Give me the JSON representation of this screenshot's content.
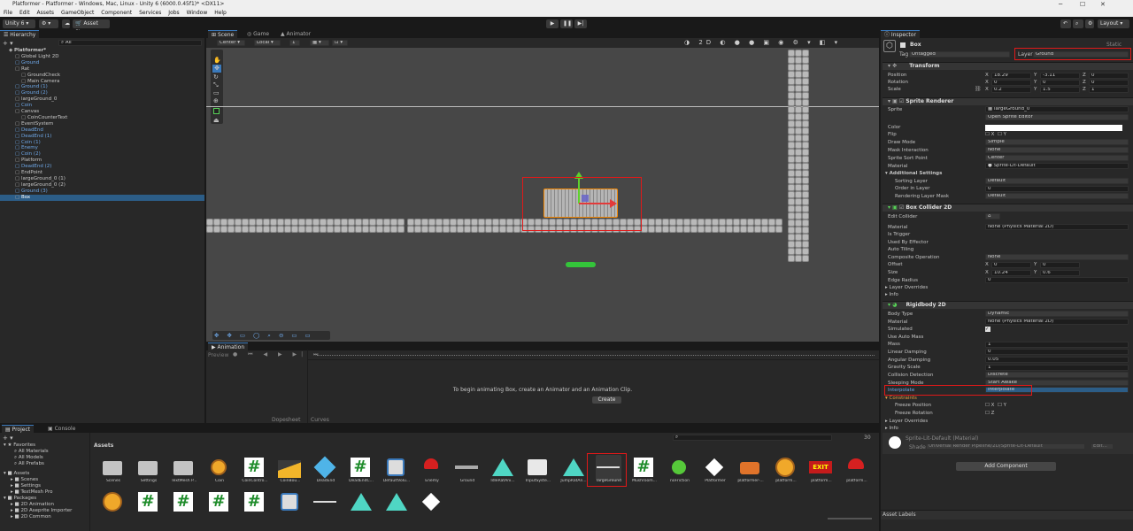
{
  "window": {
    "title": "Platformer - Platformer - Windows, Mac, Linux - Unity 6 (6000.0.45f1)* <DX11>"
  },
  "menu": [
    "File",
    "Edit",
    "Assets",
    "GameObject",
    "Component",
    "Services",
    "Jobs",
    "Window",
    "Help"
  ],
  "toolbar": {
    "account": "Unity 6",
    "asset_store": "Asset Store",
    "layout": "Layout"
  },
  "hierarchy": {
    "title": "Hierarchy",
    "search": "All",
    "items": [
      {
        "label": "Platformer*",
        "indent": 0,
        "style": "root"
      },
      {
        "label": "Global Light 2D",
        "indent": 1,
        "style": "normal"
      },
      {
        "label": "Ground",
        "indent": 1,
        "style": "blue"
      },
      {
        "label": "Rat",
        "indent": 1,
        "style": "normal"
      },
      {
        "label": "GroundCheck",
        "indent": 2,
        "style": "normal"
      },
      {
        "label": "Main Camera",
        "indent": 2,
        "style": "normal"
      },
      {
        "label": "Ground (1)",
        "indent": 1,
        "style": "blue"
      },
      {
        "label": "Ground (2)",
        "indent": 1,
        "style": "blue"
      },
      {
        "label": "largeGround_0",
        "indent": 1,
        "style": "normal"
      },
      {
        "label": "Coin",
        "indent": 1,
        "style": "blue"
      },
      {
        "label": "Canvas",
        "indent": 1,
        "style": "normal"
      },
      {
        "label": "CoinCounterText",
        "indent": 2,
        "style": "normal"
      },
      {
        "label": "EventSystem",
        "indent": 1,
        "style": "normal"
      },
      {
        "label": "DeadEnd",
        "indent": 1,
        "style": "blue"
      },
      {
        "label": "DeadEnd (1)",
        "indent": 1,
        "style": "blue"
      },
      {
        "label": "Coin (1)",
        "indent": 1,
        "style": "blue"
      },
      {
        "label": "Enemy",
        "indent": 1,
        "style": "blue"
      },
      {
        "label": "Coin (2)",
        "indent": 1,
        "style": "blue"
      },
      {
        "label": "Platform",
        "indent": 1,
        "style": "normal"
      },
      {
        "label": "DeadEnd (2)",
        "indent": 1,
        "style": "blue"
      },
      {
        "label": "EndPoint",
        "indent": 1,
        "style": "normal"
      },
      {
        "label": "largeGround_0 (1)",
        "indent": 1,
        "style": "normal"
      },
      {
        "label": "largeGround_0 (2)",
        "indent": 1,
        "style": "normal"
      },
      {
        "label": "Ground (3)",
        "indent": 1,
        "style": "blue"
      },
      {
        "label": "Box",
        "indent": 1,
        "style": "selected"
      }
    ]
  },
  "scene": {
    "tabs": [
      "Scene",
      "Game",
      "Animator"
    ],
    "pivot": "Center",
    "space": "Local",
    "grid_snap": "1"
  },
  "animation": {
    "title": "Animation",
    "preview": "Preview",
    "message": "To begin animating Box, create an Animator and an Animation Clip.",
    "create": "Create",
    "tab_dopesheet": "Dopesheet",
    "tab_curves": "Curves"
  },
  "project": {
    "tabs": [
      "Project",
      "Console"
    ],
    "count": "30",
    "favorites": "Favorites",
    "fav_items": [
      "All Materials",
      "All Models",
      "All Prefabs"
    ],
    "assets": "Assets",
    "asset_folders": [
      "Scenes",
      "Settings",
      "TextMesh Pro"
    ],
    "packages": "Packages",
    "package_items": [
      "2D Animation",
      "2D Aseprite Importer",
      "2D Common"
    ],
    "breadcrumb": "Assets",
    "grid": [
      "Scenes",
      "Settings",
      "TextMesh P...",
      "Coin",
      "CoinContro...",
      "CoinBou...",
      "DeadEnd",
      "DeadEndC...",
      "DefaultVolu...",
      "Enemy",
      "Ground",
      "IdleRatAni...",
      "InputSyste...",
      "JumpRatAn...",
      "largeGround",
      "Mushroom...",
      "noFriction",
      "Platformer",
      "platformer-...",
      "platform...",
      "platform...",
      "platform..."
    ]
  },
  "inspector": {
    "title": "Inspector",
    "object": "Box",
    "static": "Static",
    "tag_label": "Tag",
    "tag": "Untagged",
    "layer_label": "Layer",
    "layer": "Ground",
    "transform": {
      "title": "Transform",
      "position": [
        "18.29",
        "-3.11",
        "0"
      ],
      "rotation": [
        "0",
        "0",
        "0"
      ],
      "scale": [
        "0.2",
        "1.5",
        "1"
      ]
    },
    "sprite_renderer": {
      "title": "Sprite Renderer",
      "sprite": "largeGround_0",
      "open_editor": "Open Sprite Editor",
      "draw_mode": "Simple",
      "mask": "None",
      "sort_point": "Center",
      "material": "Sprite-Lit-Default",
      "sorting_layer": "Default",
      "order": "0",
      "render_mask": "Default"
    },
    "box_collider": {
      "title": "Box Collider 2D",
      "material": "None (Physics Material 2D)",
      "composite": "None",
      "offset": [
        "0",
        "0"
      ],
      "size": [
        "10.24",
        "0.6"
      ],
      "edge_radius": "0"
    },
    "rigidbody": {
      "title": "Rigidbody 2D",
      "body_type": "Dynamic",
      "material": "None (Physics Material 2D)",
      "mass": "1",
      "linear_damping": "0",
      "angular_damping": "0.05",
      "gravity": "1",
      "collision": "Discrete",
      "sleeping": "Start Awake",
      "interpolate": "Interpolate"
    },
    "mat_name": "Sprite-Lit-Default (Material)",
    "shader_label": "Shader",
    "shader": "Universal Render Pipeline/2D/Sprite-Lit-Default",
    "edit": "Edit...",
    "add_component": "Add Component",
    "asset_labels": "Asset Labels"
  },
  "colors": {
    "accent": "#3a79bb",
    "highlight": "#e01919",
    "selection": "#2c5d87"
  }
}
